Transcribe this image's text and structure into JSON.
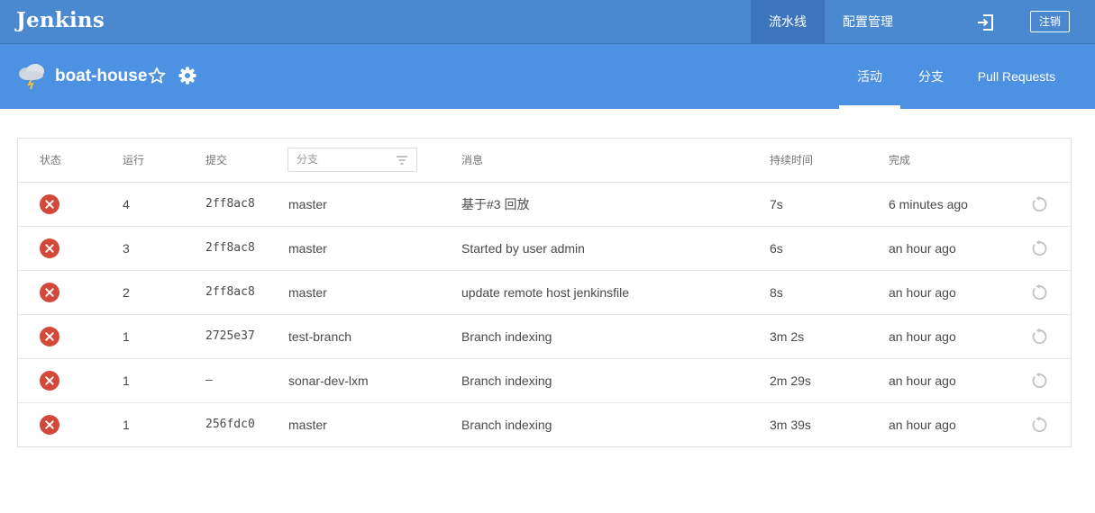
{
  "app": {
    "logo": "Jenkins"
  },
  "topnav": {
    "items": [
      {
        "label": "流水线",
        "active": true
      },
      {
        "label": "配置管理",
        "active": false
      }
    ],
    "logout_label": "注销"
  },
  "project": {
    "name": "boat-house",
    "tabs": [
      {
        "label": "活动",
        "active": true
      },
      {
        "label": "分支",
        "active": false
      },
      {
        "label": "Pull Requests",
        "active": false
      }
    ]
  },
  "table": {
    "headers": {
      "status": "状态",
      "run": "运行",
      "commit": "提交",
      "branch": "分支",
      "message": "消息",
      "duration": "持续时间",
      "completed": "完成"
    },
    "rows": [
      {
        "status": "failed",
        "run": "4",
        "commit": "2ff8ac8",
        "branch": "master",
        "message": "基于#3 回放",
        "duration": "7s",
        "completed": "6 minutes ago"
      },
      {
        "status": "failed",
        "run": "3",
        "commit": "2ff8ac8",
        "branch": "master",
        "message": "Started by user admin",
        "duration": "6s",
        "completed": "an hour ago"
      },
      {
        "status": "failed",
        "run": "2",
        "commit": "2ff8ac8",
        "branch": "master",
        "message": "update remote host jenkinsfile",
        "duration": "8s",
        "completed": "an hour ago"
      },
      {
        "status": "failed",
        "run": "1",
        "commit": "2725e37",
        "branch": "test-branch",
        "message": "Branch indexing",
        "duration": "3m 2s",
        "completed": "an hour ago"
      },
      {
        "status": "failed",
        "run": "1",
        "commit": "–",
        "branch": "sonar-dev-lxm",
        "message": "Branch indexing",
        "duration": "2m 29s",
        "completed": "an hour ago"
      },
      {
        "status": "failed",
        "run": "1",
        "commit": "256fdc0",
        "branch": "master",
        "message": "Branch indexing",
        "duration": "3m 39s",
        "completed": "an hour ago"
      }
    ]
  },
  "colors": {
    "topbar": "#4a88d0",
    "subheader": "#4d91e2",
    "failed": "#d24939"
  },
  "icons": {
    "weather": "cloudy-weather-icon",
    "favorite": "star-icon",
    "settings": "gear-icon",
    "logout": "logout-icon",
    "filter": "filter-icon",
    "status": "failed-x-icon",
    "replay": "replay-icon"
  }
}
